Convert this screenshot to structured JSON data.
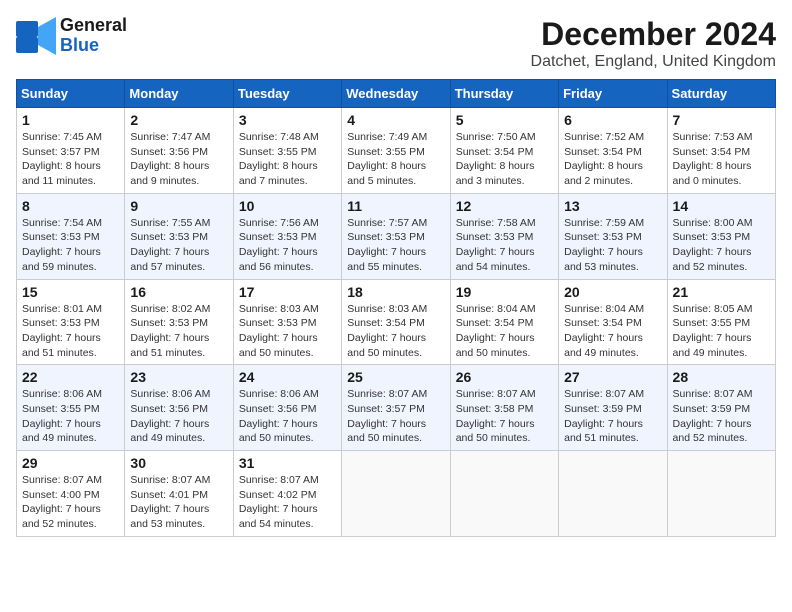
{
  "header": {
    "logo_line1": "General",
    "logo_line2": "Blue",
    "month": "December 2024",
    "location": "Datchet, England, United Kingdom"
  },
  "weekdays": [
    "Sunday",
    "Monday",
    "Tuesday",
    "Wednesday",
    "Thursday",
    "Friday",
    "Saturday"
  ],
  "weeks": [
    [
      {
        "day": "1",
        "lines": [
          "Sunrise: 7:45 AM",
          "Sunset: 3:57 PM",
          "Daylight: 8 hours",
          "and 11 minutes."
        ]
      },
      {
        "day": "2",
        "lines": [
          "Sunrise: 7:47 AM",
          "Sunset: 3:56 PM",
          "Daylight: 8 hours",
          "and 9 minutes."
        ]
      },
      {
        "day": "3",
        "lines": [
          "Sunrise: 7:48 AM",
          "Sunset: 3:55 PM",
          "Daylight: 8 hours",
          "and 7 minutes."
        ]
      },
      {
        "day": "4",
        "lines": [
          "Sunrise: 7:49 AM",
          "Sunset: 3:55 PM",
          "Daylight: 8 hours",
          "and 5 minutes."
        ]
      },
      {
        "day": "5",
        "lines": [
          "Sunrise: 7:50 AM",
          "Sunset: 3:54 PM",
          "Daylight: 8 hours",
          "and 3 minutes."
        ]
      },
      {
        "day": "6",
        "lines": [
          "Sunrise: 7:52 AM",
          "Sunset: 3:54 PM",
          "Daylight: 8 hours",
          "and 2 minutes."
        ]
      },
      {
        "day": "7",
        "lines": [
          "Sunrise: 7:53 AM",
          "Sunset: 3:54 PM",
          "Daylight: 8 hours",
          "and 0 minutes."
        ]
      }
    ],
    [
      {
        "day": "8",
        "lines": [
          "Sunrise: 7:54 AM",
          "Sunset: 3:53 PM",
          "Daylight: 7 hours",
          "and 59 minutes."
        ]
      },
      {
        "day": "9",
        "lines": [
          "Sunrise: 7:55 AM",
          "Sunset: 3:53 PM",
          "Daylight: 7 hours",
          "and 57 minutes."
        ]
      },
      {
        "day": "10",
        "lines": [
          "Sunrise: 7:56 AM",
          "Sunset: 3:53 PM",
          "Daylight: 7 hours",
          "and 56 minutes."
        ]
      },
      {
        "day": "11",
        "lines": [
          "Sunrise: 7:57 AM",
          "Sunset: 3:53 PM",
          "Daylight: 7 hours",
          "and 55 minutes."
        ]
      },
      {
        "day": "12",
        "lines": [
          "Sunrise: 7:58 AM",
          "Sunset: 3:53 PM",
          "Daylight: 7 hours",
          "and 54 minutes."
        ]
      },
      {
        "day": "13",
        "lines": [
          "Sunrise: 7:59 AM",
          "Sunset: 3:53 PM",
          "Daylight: 7 hours",
          "and 53 minutes."
        ]
      },
      {
        "day": "14",
        "lines": [
          "Sunrise: 8:00 AM",
          "Sunset: 3:53 PM",
          "Daylight: 7 hours",
          "and 52 minutes."
        ]
      }
    ],
    [
      {
        "day": "15",
        "lines": [
          "Sunrise: 8:01 AM",
          "Sunset: 3:53 PM",
          "Daylight: 7 hours",
          "and 51 minutes."
        ]
      },
      {
        "day": "16",
        "lines": [
          "Sunrise: 8:02 AM",
          "Sunset: 3:53 PM",
          "Daylight: 7 hours",
          "and 51 minutes."
        ]
      },
      {
        "day": "17",
        "lines": [
          "Sunrise: 8:03 AM",
          "Sunset: 3:53 PM",
          "Daylight: 7 hours",
          "and 50 minutes."
        ]
      },
      {
        "day": "18",
        "lines": [
          "Sunrise: 8:03 AM",
          "Sunset: 3:54 PM",
          "Daylight: 7 hours",
          "and 50 minutes."
        ]
      },
      {
        "day": "19",
        "lines": [
          "Sunrise: 8:04 AM",
          "Sunset: 3:54 PM",
          "Daylight: 7 hours",
          "and 50 minutes."
        ]
      },
      {
        "day": "20",
        "lines": [
          "Sunrise: 8:04 AM",
          "Sunset: 3:54 PM",
          "Daylight: 7 hours",
          "and 49 minutes."
        ]
      },
      {
        "day": "21",
        "lines": [
          "Sunrise: 8:05 AM",
          "Sunset: 3:55 PM",
          "Daylight: 7 hours",
          "and 49 minutes."
        ]
      }
    ],
    [
      {
        "day": "22",
        "lines": [
          "Sunrise: 8:06 AM",
          "Sunset: 3:55 PM",
          "Daylight: 7 hours",
          "and 49 minutes."
        ]
      },
      {
        "day": "23",
        "lines": [
          "Sunrise: 8:06 AM",
          "Sunset: 3:56 PM",
          "Daylight: 7 hours",
          "and 49 minutes."
        ]
      },
      {
        "day": "24",
        "lines": [
          "Sunrise: 8:06 AM",
          "Sunset: 3:56 PM",
          "Daylight: 7 hours",
          "and 50 minutes."
        ]
      },
      {
        "day": "25",
        "lines": [
          "Sunrise: 8:07 AM",
          "Sunset: 3:57 PM",
          "Daylight: 7 hours",
          "and 50 minutes."
        ]
      },
      {
        "day": "26",
        "lines": [
          "Sunrise: 8:07 AM",
          "Sunset: 3:58 PM",
          "Daylight: 7 hours",
          "and 50 minutes."
        ]
      },
      {
        "day": "27",
        "lines": [
          "Sunrise: 8:07 AM",
          "Sunset: 3:59 PM",
          "Daylight: 7 hours",
          "and 51 minutes."
        ]
      },
      {
        "day": "28",
        "lines": [
          "Sunrise: 8:07 AM",
          "Sunset: 3:59 PM",
          "Daylight: 7 hours",
          "and 52 minutes."
        ]
      }
    ],
    [
      {
        "day": "29",
        "lines": [
          "Sunrise: 8:07 AM",
          "Sunset: 4:00 PM",
          "Daylight: 7 hours",
          "and 52 minutes."
        ]
      },
      {
        "day": "30",
        "lines": [
          "Sunrise: 8:07 AM",
          "Sunset: 4:01 PM",
          "Daylight: 7 hours",
          "and 53 minutes."
        ]
      },
      {
        "day": "31",
        "lines": [
          "Sunrise: 8:07 AM",
          "Sunset: 4:02 PM",
          "Daylight: 7 hours",
          "and 54 minutes."
        ]
      },
      null,
      null,
      null,
      null
    ]
  ]
}
